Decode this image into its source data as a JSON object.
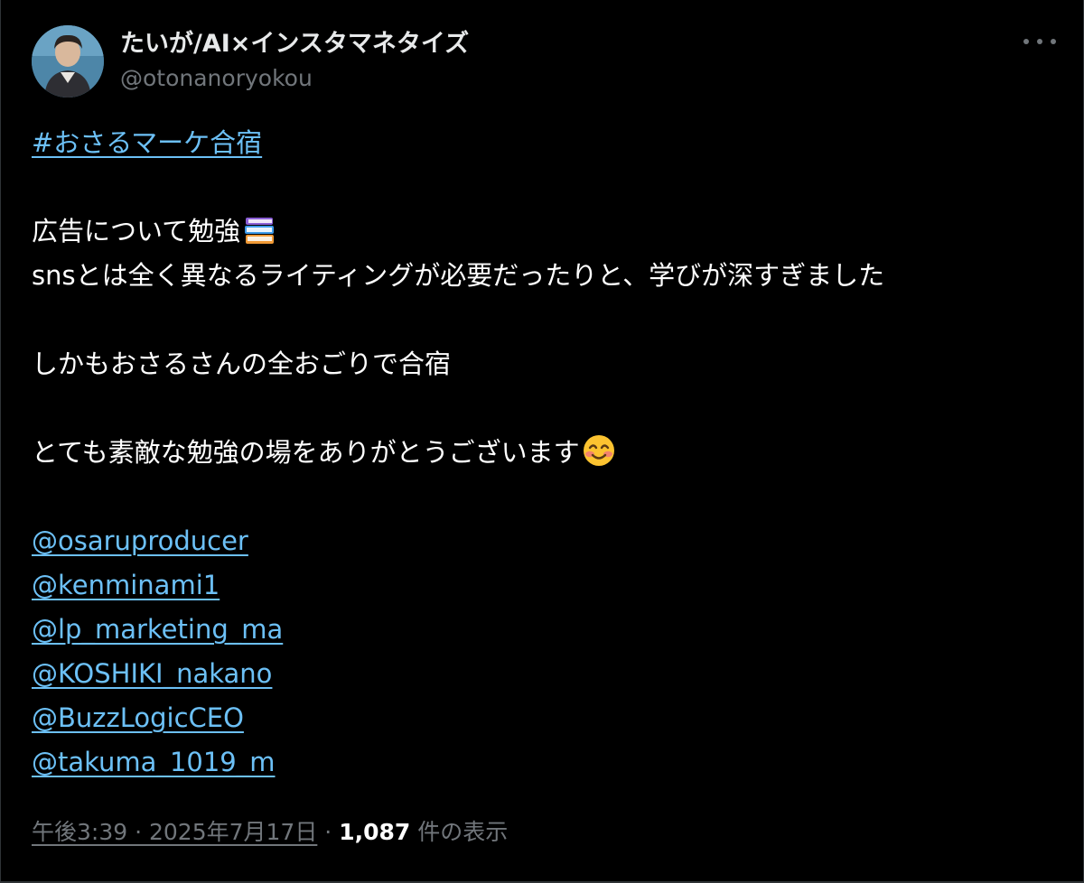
{
  "author": {
    "display_name": "たいが/AI×インスタマネタイズ",
    "handle": "@otonanoryokou",
    "avatar_icon": "user-avatar"
  },
  "tweet": {
    "hashtag": "#おさるマーケ合宿",
    "line1": "広告について勉強",
    "line1_emoji": "books-emoji",
    "line2": "snsとは全く異なるライティングが必要だったりと、学びが深すぎました",
    "line3": "しかもおさるさんの全おごりで合宿",
    "line4": "とても素敵な勉強の場をありがとうございます",
    "line4_emoji": "smiling-face-emoji",
    "mentions": [
      "@osaruproducer",
      "@kenminami1",
      "@lp_marketing_ma",
      "@KOSHIKI_nakano",
      "@BuzzLogicCEO",
      "@takuma_1019_m"
    ]
  },
  "meta": {
    "timestamp": "午後3:39 · 2025年7月17日",
    "separator": "·",
    "views_count": "1,087",
    "views_label": "件の表示"
  },
  "colors": {
    "background": "#000000",
    "link": "#6cc0f6",
    "muted": "#71767b",
    "text": "#ffffff"
  }
}
